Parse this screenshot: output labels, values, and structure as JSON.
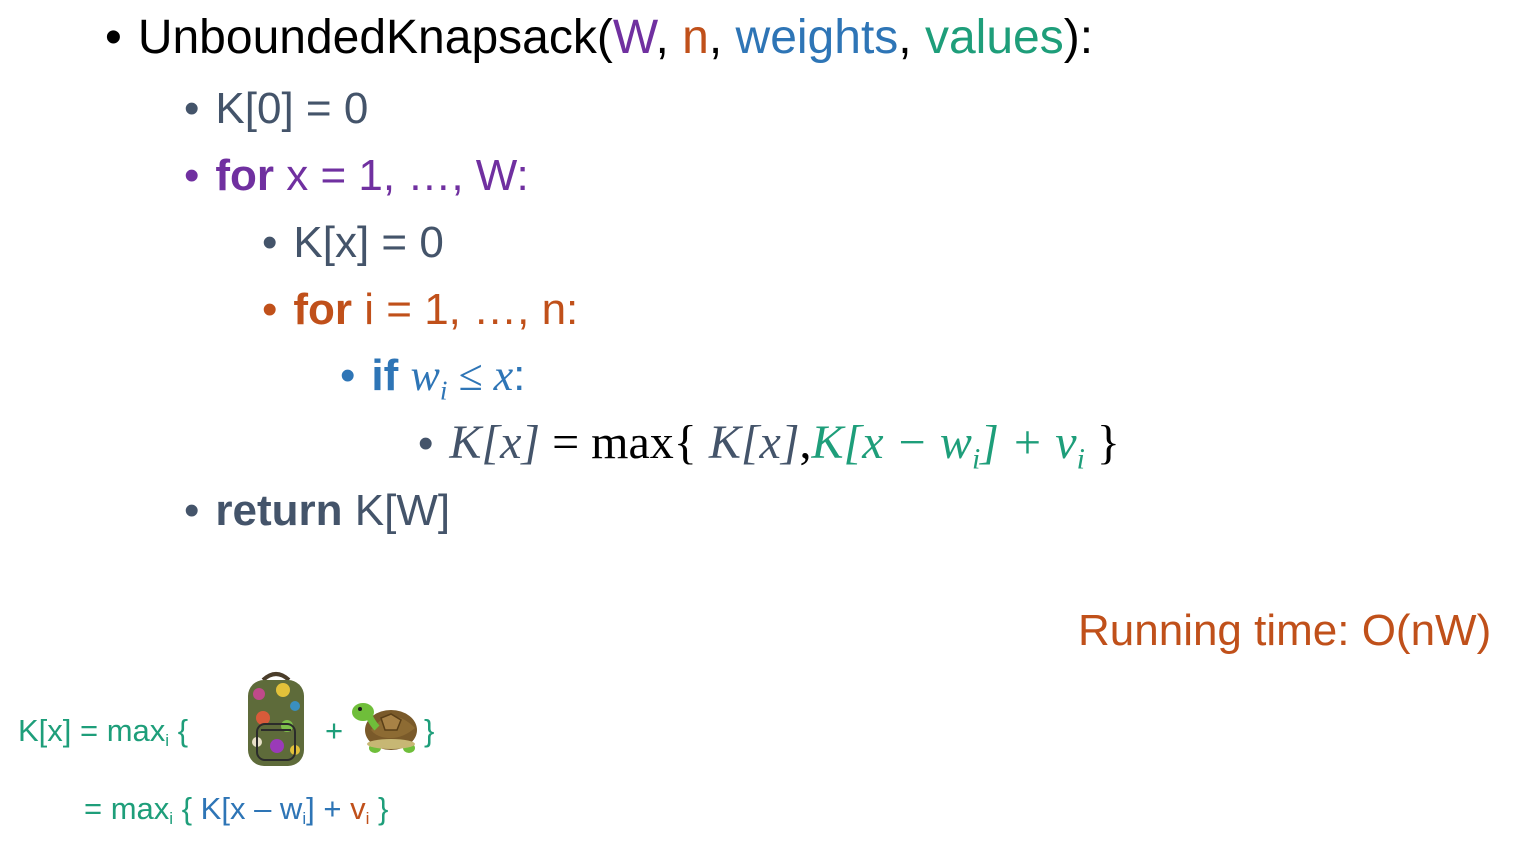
{
  "colors": {
    "black": "#000000",
    "purple": "#7030a0",
    "orange": "#c0501a",
    "blue": "#2e75b6",
    "teal": "#1e9e7a",
    "slate": "#44546a"
  },
  "line1": {
    "bullet": "•",
    "func": "UnboundedKnapsack(",
    "p1": "W",
    "c1": ", ",
    "p2": "n",
    "c2": ", ",
    "p3": "weights",
    "c3": ", ",
    "p4": "values",
    "end": "):"
  },
  "line2": {
    "bullet": "•",
    "text": "K[0] = 0"
  },
  "line3": {
    "bullet": "•",
    "kw": "for",
    "text": " x = 1, …, W:"
  },
  "line4": {
    "bullet": "•",
    "text": "K[x] = 0"
  },
  "line5": {
    "bullet": "•",
    "kw": "for",
    "text": " i = 1, …, n:"
  },
  "line6": {
    "bullet": "•",
    "kw": "if",
    "w": "w",
    "i": "i",
    "le": " ≤ ",
    "x": "x",
    "colon": ":"
  },
  "line7": {
    "bullet": "•",
    "lhs": "K[x]",
    "eq": " = max{ ",
    "a": "K[x]",
    "comma": ",",
    "b1": "K[x  − w",
    "b_sub": "i",
    "b2": "] + v",
    "b_sub2": "i",
    "close": " }"
  },
  "line8": {
    "bullet": "•",
    "kw": "return",
    "text": " K[W]"
  },
  "running_time": "Running time: O(nW)",
  "pic_eq1": {
    "left": "K[x] = max",
    "sub": "i",
    "brace": " {",
    "plus": "+",
    "close": "}"
  },
  "pic_eq2": {
    "eq": "= max",
    "sub": "i",
    "open": " { ",
    "k": "K[x – w",
    "ksub": "i",
    "k2": "] + ",
    "v": "v",
    "vsub": "i",
    "close": " }"
  },
  "icons": {
    "backpack": "backpack-icon",
    "turtle": "turtle-icon"
  }
}
